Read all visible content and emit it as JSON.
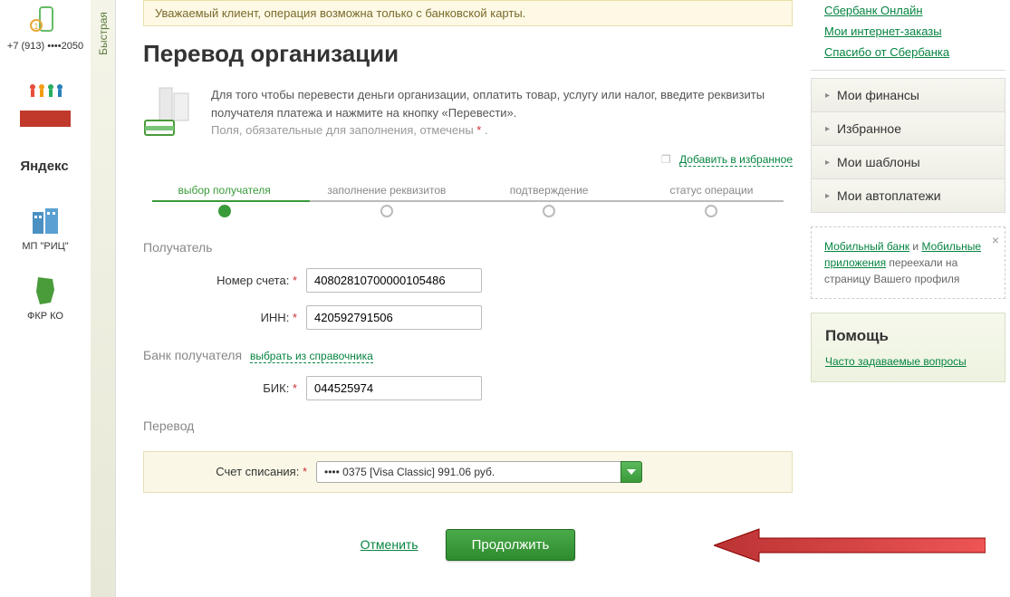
{
  "leftRail": {
    "phone": "+7 (913) ••••2050",
    "items": [
      "",
      "Яндекс",
      "МП \"РИЦ\"",
      "ФКР КО"
    ]
  },
  "quickTab": "Быстрая",
  "alert": "Уважаемый клиент, операция возможна только с банковской карты.",
  "title": "Перевод организации",
  "intro": {
    "line1": "Для того чтобы перевести деньги организации, оплатить товар, услугу или налог, введите реквизиты получателя платежа и нажмите на кнопку «Перевести».",
    "note": "Поля, обязательные для заполнения, отмечены "
  },
  "favLink": "Добавить в избранное",
  "steps": [
    "выбор получателя",
    "заполнение реквизитов",
    "подтверждение",
    "статус операции"
  ],
  "sections": {
    "recipient": "Получатель",
    "bank": "Банк получателя",
    "bankLink": "выбрать из справочника",
    "transfer": "Перевод"
  },
  "fields": {
    "account": {
      "label": "Номер счета:",
      "value": "40802810700000105486"
    },
    "inn": {
      "label": "ИНН:",
      "value": "420592791506"
    },
    "bik": {
      "label": "БИК:",
      "value": "044525974"
    },
    "debit": {
      "label": "Счет списания:",
      "value": "•••• 0375 [Visa Classic] 991.06 руб."
    }
  },
  "actions": {
    "cancel": "Отменить",
    "continue": "Продолжить"
  },
  "rightLinks": [
    "Сбербанк Онлайн",
    "Мои интернет-заказы",
    "Спасибо от Сбербанка"
  ],
  "accordion": [
    "Мои финансы",
    "Избранное",
    "Мои шаблоны",
    "Мои автоплатежи"
  ],
  "notice": {
    "link1": "Мобильный банк",
    "mid": " и ",
    "link2": "Мобильные приложения",
    "tail": " переехали на страницу Вашего профиля"
  },
  "help": {
    "title": "Помощь",
    "link": "Часто задаваемые вопросы"
  }
}
